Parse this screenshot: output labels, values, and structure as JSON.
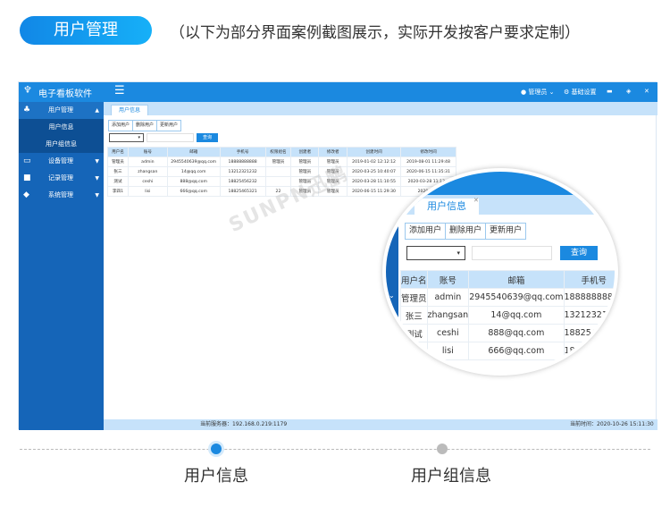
{
  "banner": {
    "title": "用户管理",
    "subtitle": "（以下为部分界面案例截图展示，实际开发按客户要求定制）"
  },
  "app": {
    "name": "电子看板软件",
    "user": "管理员",
    "settings": "基础设置"
  },
  "sidebar": {
    "items": [
      {
        "label": "用户管理",
        "icon": "users-icon"
      },
      {
        "label": "设备管理",
        "icon": "monitor-icon"
      },
      {
        "label": "记录管理",
        "icon": "briefcase-icon"
      },
      {
        "label": "系统管理",
        "icon": "cube-icon"
      }
    ],
    "sub": [
      "用户信息",
      "用户组信息"
    ]
  },
  "tab": "用户信息",
  "toolbar": {
    "add": "添加用户",
    "delete": "删除用户",
    "update": "更新用户",
    "search": "查询"
  },
  "table": {
    "headers": [
      "用户名",
      "账号",
      "邮箱",
      "手机号",
      "权限组名",
      "创建者",
      "修改者",
      "创建时间",
      "修改时间"
    ],
    "rows": [
      [
        "管理员",
        "admin",
        "2945540639@qq.com",
        "18888888888",
        "管理员",
        "管理员",
        "管理员",
        "2019-01-02 12:12:12",
        "2019-08-01 11:29:48"
      ],
      [
        "张三",
        "zhangsan",
        "14@qq.com",
        "13212321232",
        "",
        "管理员",
        "管理员",
        "2020-03-25 10:40:07",
        "2020-06-15 11:35:31"
      ],
      [
        "测试",
        "ceshi",
        "888@qq.com",
        "18825456232",
        "",
        "管理员",
        "管理员",
        "2020-03-28 11:10:55",
        "2020-03-28 11:13:4"
      ],
      [
        "李四1",
        "lisi",
        "666@qq.com",
        "18825465321",
        "22",
        "管理员",
        "管理员",
        "2020-06-15 11:29:30",
        "2020-06-1"
      ]
    ]
  },
  "status": {
    "server": "当前服务器：192.168.0.219:1179",
    "time": "当前时间：2020-10-26 15:11:30"
  },
  "watermark": "SUNPN迅鹏",
  "footer": {
    "left": "用户信息",
    "right": "用户组信息"
  },
  "colors": {
    "accent": "#1b89e0",
    "sidebar": "#1565b8",
    "light": "#c6e2fa"
  }
}
